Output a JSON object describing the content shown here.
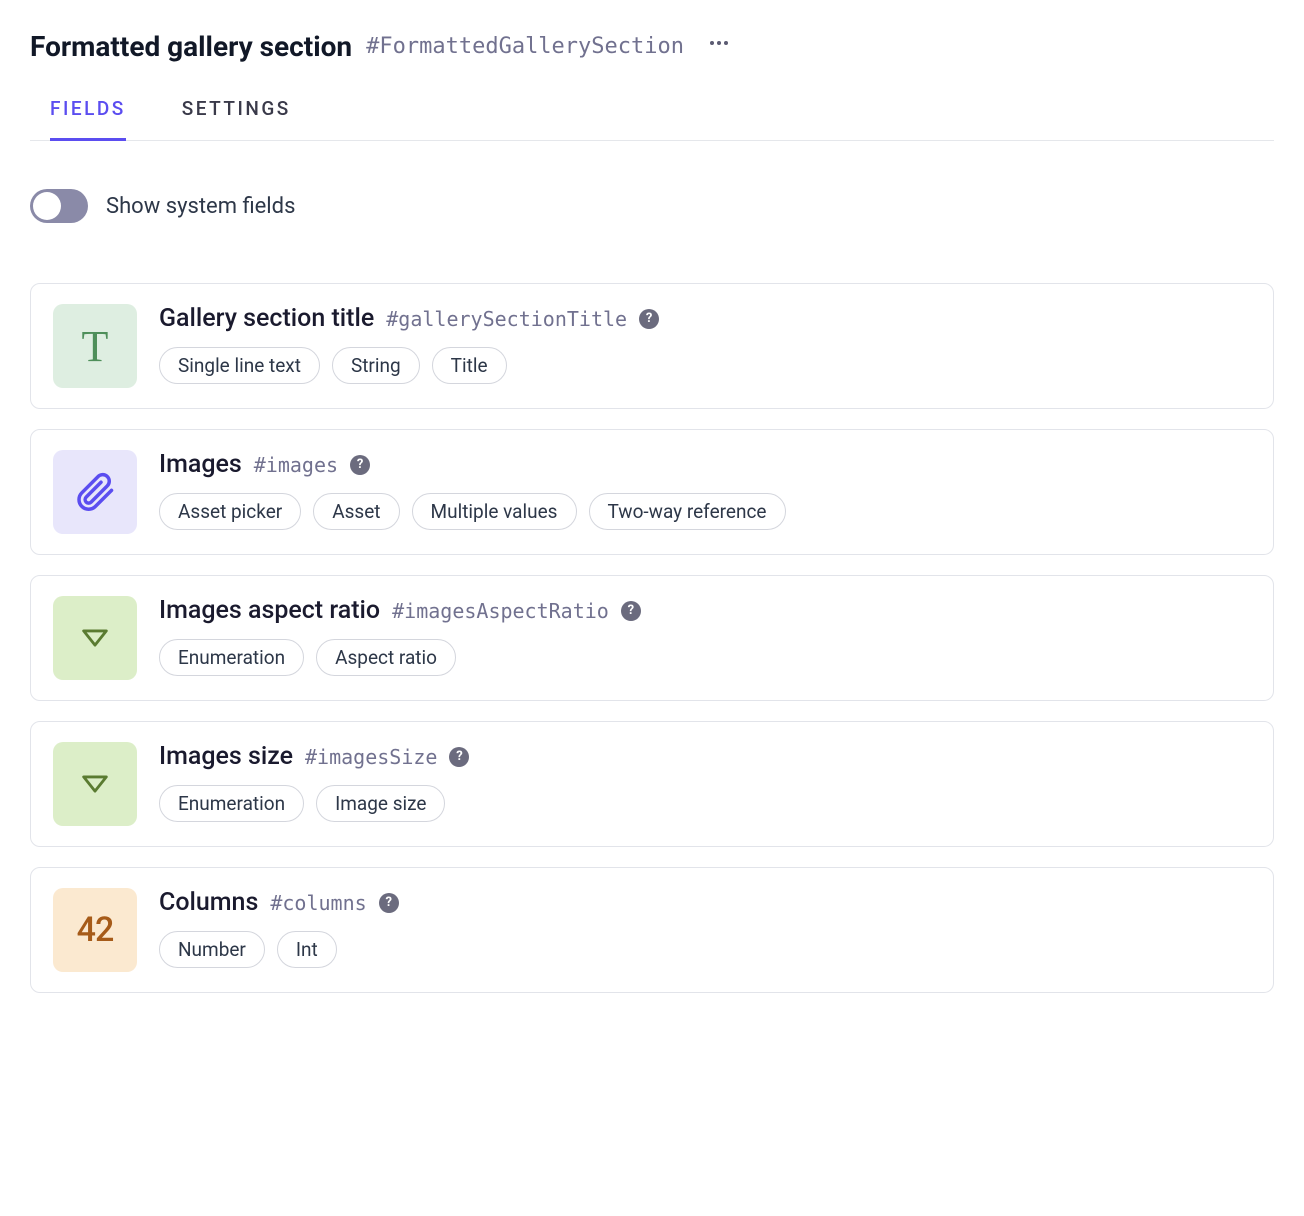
{
  "header": {
    "title": "Formatted gallery section",
    "api_id": "#FormattedGallerySection"
  },
  "tabs": {
    "fields": "FIELDS",
    "settings": "SETTINGS"
  },
  "toggle": {
    "label": "Show system fields"
  },
  "icons": {
    "text_glyph": "T",
    "number_glyph": "42",
    "help_glyph": "?"
  },
  "fields": [
    {
      "name": "Gallery section title",
      "api_id": "#gallerySectionTitle",
      "icon_type": "text",
      "pills": [
        "Single line text",
        "String",
        "Title"
      ]
    },
    {
      "name": "Images",
      "api_id": "#images",
      "icon_type": "asset",
      "pills": [
        "Asset picker",
        "Asset",
        "Multiple values",
        "Two-way reference"
      ]
    },
    {
      "name": "Images aspect ratio",
      "api_id": "#imagesAspectRatio",
      "icon_type": "enum",
      "pills": [
        "Enumeration",
        "Aspect ratio"
      ]
    },
    {
      "name": "Images size",
      "api_id": "#imagesSize",
      "icon_type": "enum",
      "pills": [
        "Enumeration",
        "Image size"
      ]
    },
    {
      "name": "Columns",
      "api_id": "#columns",
      "icon_type": "number",
      "pills": [
        "Number",
        "Int"
      ]
    }
  ]
}
